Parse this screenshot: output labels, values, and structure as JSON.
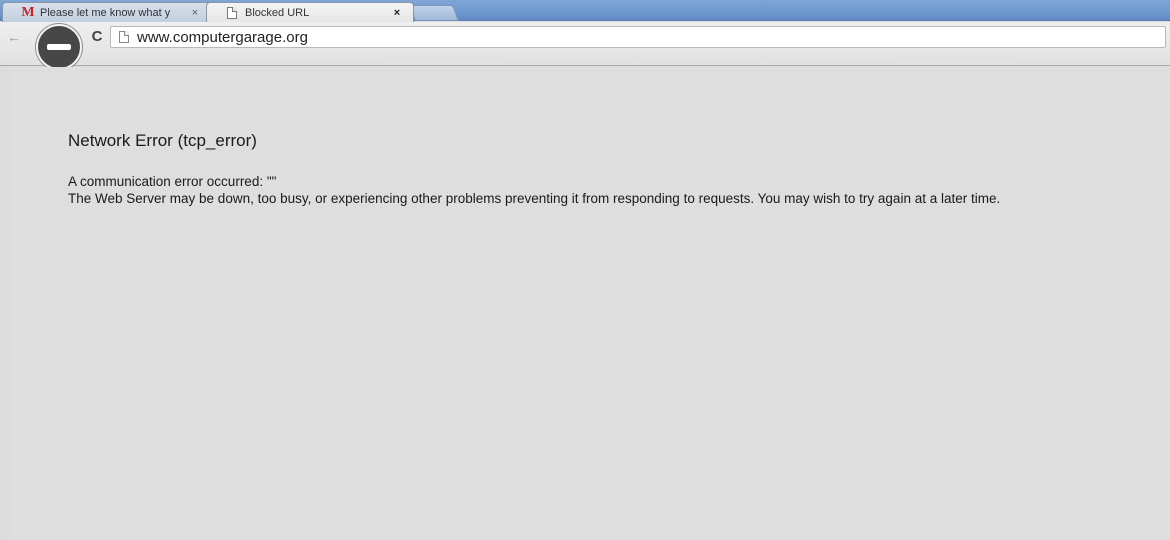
{
  "tabs": [
    {
      "title": "Please let me know what y",
      "close": "×",
      "favicon": "gmail-icon",
      "favicon_glyph": "M"
    },
    {
      "title": "Blocked URL",
      "close": "×",
      "favicon": "document-icon"
    }
  ],
  "toolbar": {
    "back_glyph": "←",
    "reload_glyph": "C",
    "url": "www.computergarage.org"
  },
  "error": {
    "title": "Network Error (tcp_error)",
    "line1": "A communication error occurred: \"\"",
    "line2": "The Web Server may be down, too busy, or experiencing other problems preventing it from responding to requests. You may wish to try again at a later time."
  },
  "colors": {
    "tabstrip": "#6e98cf",
    "page_background": "#dedede",
    "gmail_red": "#c3272b"
  }
}
